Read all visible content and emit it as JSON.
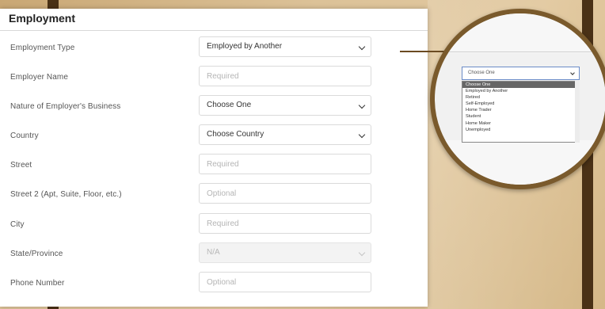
{
  "section": {
    "title": "Employment"
  },
  "fields": [
    {
      "label": "Employment Type",
      "value": "Employed by Another",
      "type": "select"
    },
    {
      "label": "Employer Name",
      "placeholder": "Required",
      "type": "input"
    },
    {
      "label": "Nature of Employer's Business",
      "value": "Choose One",
      "type": "select"
    },
    {
      "label": "Country",
      "value": "Choose Country",
      "type": "select"
    },
    {
      "label": "Street",
      "placeholder": "Required",
      "type": "input"
    },
    {
      "label": "Street 2 (Apt, Suite, Floor, etc.)",
      "placeholder": "Optional",
      "type": "input"
    },
    {
      "label": "City",
      "placeholder": "Required",
      "type": "input"
    },
    {
      "label": "State/Province",
      "value": "N/A",
      "type": "select-disabled"
    },
    {
      "label": "Phone Number",
      "placeholder": "Optional",
      "type": "input"
    }
  ],
  "magnifier": {
    "select_value": "Choose One",
    "options": [
      "Choose One",
      "Employed by Another",
      "Retired",
      "Self-Employed",
      "Home Trader",
      "Student",
      "Home Maker",
      "Unemployed"
    ],
    "selected_index": 0
  },
  "colors": {
    "background": "#dcc298",
    "bar": "#4a3116",
    "magnifier_border": "#7a5a2c",
    "focus_border": "#6a8bc7"
  },
  "icons": {
    "dropdown": "chevron-down-icon"
  }
}
